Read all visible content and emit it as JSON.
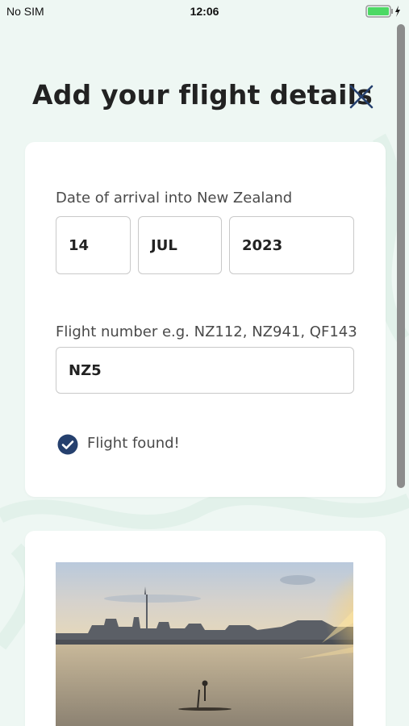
{
  "status_bar": {
    "carrier": "No SIM",
    "time": "12:06"
  },
  "header": {
    "title": "Add your flight details",
    "close_icon": "close-icon"
  },
  "arrival": {
    "label": "Date of arrival into New Zealand",
    "day": "14",
    "month": "JUL",
    "year": "2023"
  },
  "flight": {
    "label": "Flight number e.g. NZ112, NZ941, QF143",
    "value": "NZ5"
  },
  "status": {
    "icon": "check-circle-icon",
    "text": "Flight found!"
  },
  "colors": {
    "background": "#eef7f3",
    "accent": "#25406e",
    "card": "#ffffff"
  }
}
